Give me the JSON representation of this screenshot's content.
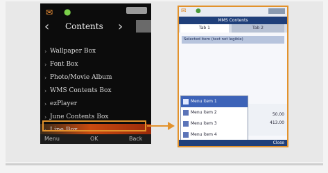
{
  "left_screen": {
    "title": "Contents",
    "items": [
      "Wallpaper Box",
      "Font Box",
      "Photo/Movie Album",
      "WMS Contents Box",
      "ezPlayer",
      "June Contents Box",
      "Line Box"
    ],
    "selected_index": 6,
    "softkeys": [
      "Menu",
      "OK",
      "Back"
    ]
  },
  "right_screen": {
    "title": "MMS Contents",
    "tabs": [
      "Tab 1",
      "Tab 2"
    ],
    "row_text": "Selected item (text not legible)",
    "menu_items": [
      "Menu item 1",
      "Menu item 2",
      "Menu item 3",
      "Menu item 4"
    ],
    "side_values": [
      "50.00",
      "413.00"
    ],
    "softkey": "Close"
  },
  "colors": {
    "highlight": "#e2922c",
    "left_bg": "#0c0c0c",
    "right_title_bg": "#1f3f7a"
  }
}
